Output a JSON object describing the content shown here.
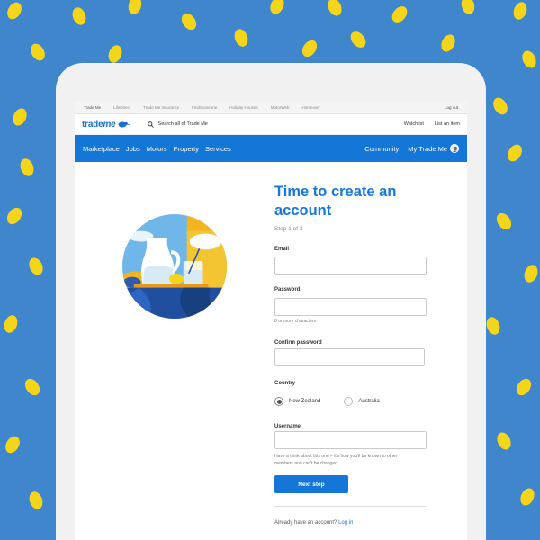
{
  "topbar": {
    "links": [
      "Trade Me",
      "LifeDirect",
      "Trade Me Insurance",
      "FindSomeone",
      "Holiday Houses",
      "MotorWeb",
      "Homeowy"
    ],
    "logout": "Log out"
  },
  "header": {
    "logo_trade": "trade",
    "logo_me": "me",
    "search_placeholder": "Search all of Trade Me",
    "watchlist": "Watchlist",
    "list_item": "List an item"
  },
  "nav": {
    "items": [
      "Marketplace",
      "Jobs",
      "Motors",
      "Property",
      "Services"
    ],
    "community": "Community",
    "my_trade_me": "My Trade Me"
  },
  "form": {
    "title_line1": "Time to create an",
    "title_line2": "account",
    "step": "Step 1 of 2",
    "email_label": "Email",
    "password_label": "Password",
    "password_hint": "8 or more characters",
    "confirm_label": "Confirm password",
    "country_label": "Country",
    "country_nz": "New Zealand",
    "country_au": "Australia",
    "selected_country": "New Zealand",
    "username_label": "Username",
    "username_hint_1": "Have a think about this one – it's how you'll be known to other",
    "username_hint_2": "members and can't be changed.",
    "next_button": "Next step",
    "already_text": "Already have an account?",
    "login_link": "Log in"
  },
  "colors": {
    "background": "#3f86cc",
    "lemon": "#f4d51a",
    "accent_blue": "#1477d8"
  }
}
